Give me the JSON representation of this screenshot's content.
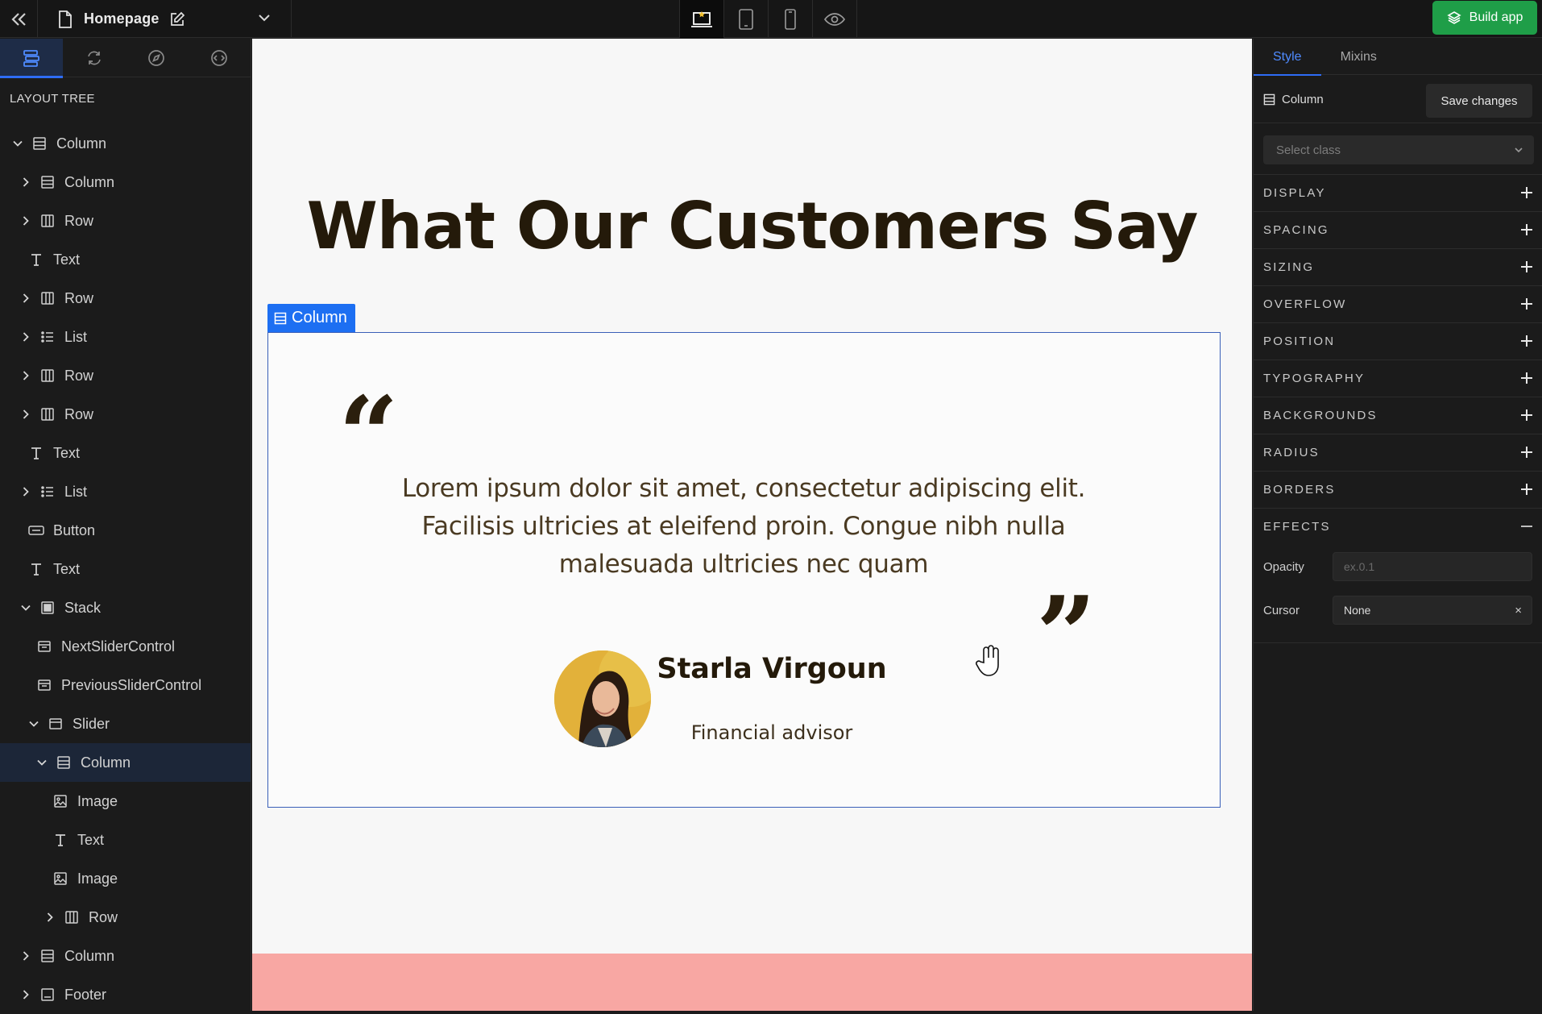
{
  "topbar": {
    "page_title": "Homepage",
    "build_label": "Build app"
  },
  "left_panel": {
    "heading": "LAYOUT TREE",
    "tree": [
      {
        "label": "Column",
        "icon": "column-icon",
        "depth": 0,
        "caret": "down"
      },
      {
        "label": "Column",
        "icon": "column-icon",
        "depth": 1,
        "caret": "right"
      },
      {
        "label": "Row",
        "icon": "row-icon",
        "depth": 1,
        "caret": "right"
      },
      {
        "label": "Text",
        "icon": "text-icon",
        "depth": 1,
        "caret": "none"
      },
      {
        "label": "Row",
        "icon": "row-icon",
        "depth": 1,
        "caret": "right"
      },
      {
        "label": "List",
        "icon": "list-icon",
        "depth": 1,
        "caret": "right"
      },
      {
        "label": "Row",
        "icon": "row-icon",
        "depth": 1,
        "caret": "right"
      },
      {
        "label": "Row",
        "icon": "row-icon",
        "depth": 1,
        "caret": "right"
      },
      {
        "label": "Text",
        "icon": "text-icon",
        "depth": 1,
        "caret": "none"
      },
      {
        "label": "List",
        "icon": "list-icon",
        "depth": 1,
        "caret": "right"
      },
      {
        "label": "Button",
        "icon": "button-icon",
        "depth": 1,
        "caret": "none"
      },
      {
        "label": "Text",
        "icon": "text-icon",
        "depth": 1,
        "caret": "none"
      },
      {
        "label": "Stack",
        "icon": "stack-icon",
        "depth": 1,
        "caret": "down"
      },
      {
        "label": "NextSliderControl",
        "icon": "component-icon",
        "depth": 2,
        "caret": "none"
      },
      {
        "label": "PreviousSliderControl",
        "icon": "component-icon",
        "depth": 2,
        "caret": "none"
      },
      {
        "label": "Slider",
        "icon": "slider-icon",
        "depth": 2,
        "caret": "down"
      },
      {
        "label": "Column",
        "icon": "column-icon",
        "depth": 3,
        "caret": "down",
        "selected": true
      },
      {
        "label": "Image",
        "icon": "image-icon",
        "depth": 4,
        "caret": "none"
      },
      {
        "label": "Text",
        "icon": "text-icon",
        "depth": 4,
        "caret": "none"
      },
      {
        "label": "Image",
        "icon": "image-icon",
        "depth": 4,
        "caret": "none"
      },
      {
        "label": "Row",
        "icon": "row-icon",
        "depth": 4,
        "caret": "right"
      },
      {
        "label": "Column",
        "icon": "column-icon",
        "depth": 1,
        "caret": "right"
      },
      {
        "label": "Footer",
        "icon": "footer-icon",
        "depth": 1,
        "caret": "right"
      }
    ]
  },
  "canvas": {
    "heading": "What Our Customers Say",
    "selection_label": "Column",
    "quote_open": "“",
    "quote_close": "”",
    "quote": "Lorem ipsum dolor sit amet, consectetur adipiscing elit. Facilisis ultricies at eleifend proin. Congue nibh nulla malesuada ultricies nec quam",
    "person_name": "Starla Virgoun",
    "person_role": "Financial advisor"
  },
  "right_panel": {
    "tabs": [
      "Style",
      "Mixins"
    ],
    "element_name": "Column",
    "save_label": "Save changes",
    "class_placeholder": "Select class",
    "sections": [
      "DISPLAY",
      "SPACING",
      "SIZING",
      "OVERFLOW",
      "POSITION",
      "TYPOGRAPHY",
      "BACKGROUNDS",
      "RADIUS",
      "BORDERS",
      "EFFECTS"
    ],
    "effects": {
      "opacity_label": "Opacity",
      "opacity_placeholder": "ex.0.1",
      "cursor_label": "Cursor",
      "cursor_value": "None",
      "clear_symbol": "×"
    }
  },
  "colors": {
    "accent": "#2e6cf6",
    "build_green": "#1f9e48",
    "heading_text": "#241a0a",
    "footer_pink": "#f8a7a3"
  }
}
